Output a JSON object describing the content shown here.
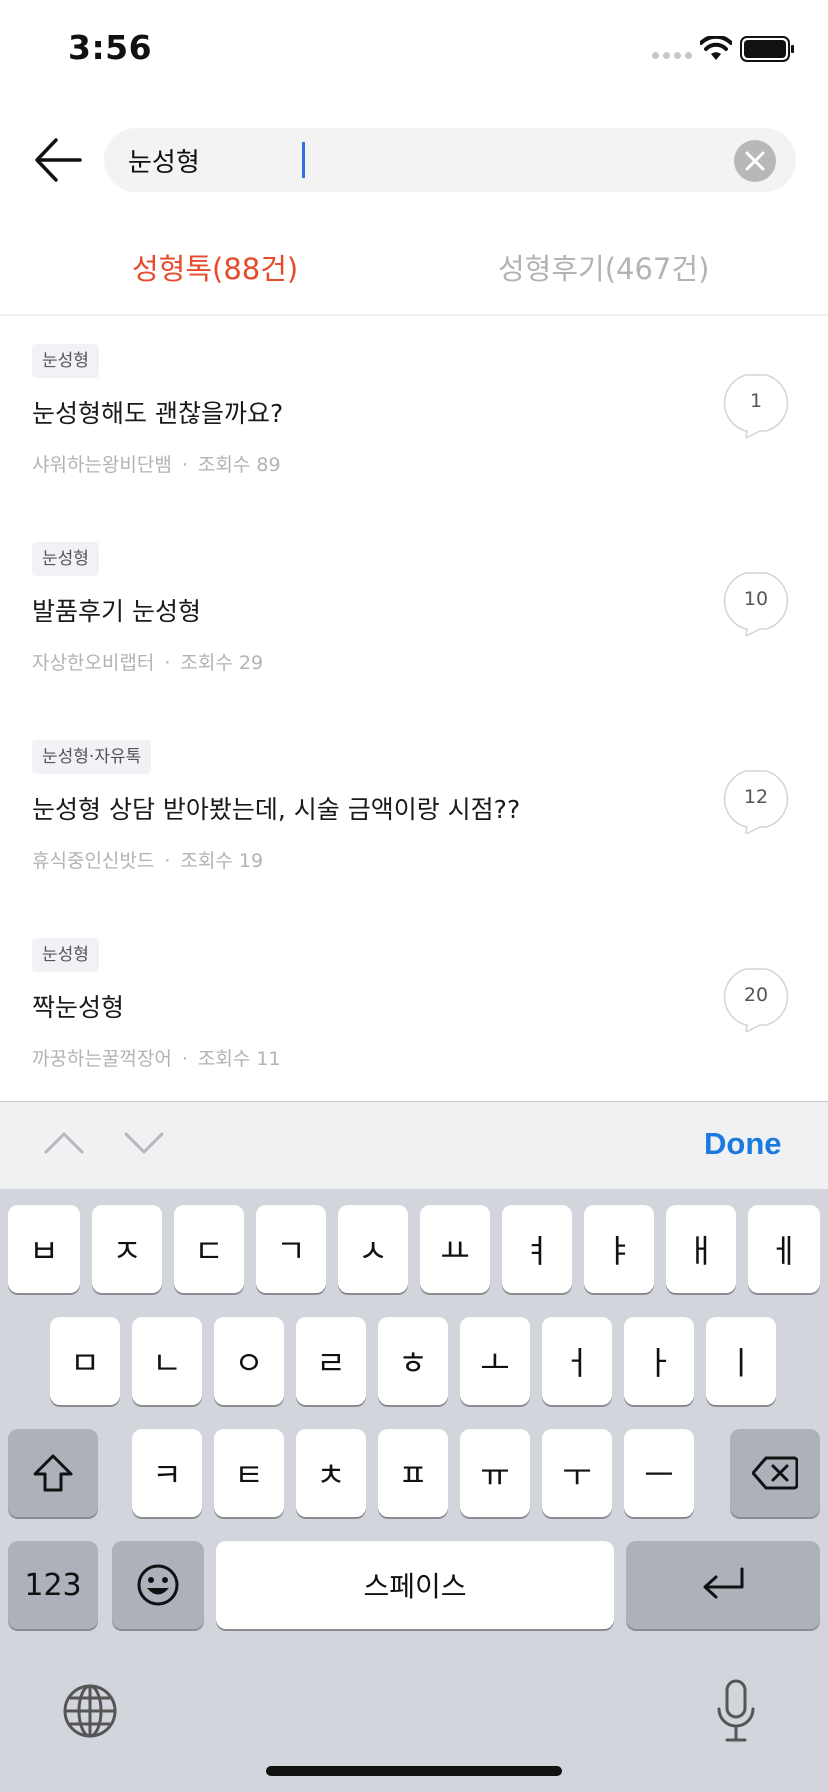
{
  "status_bar": {
    "time": "3:56"
  },
  "search": {
    "query": "눈성형"
  },
  "tabs": [
    {
      "label": "성형톡(88건)",
      "active": true
    },
    {
      "label": "성형후기(467건)",
      "active": false
    }
  ],
  "posts": [
    {
      "tag": "눈성형",
      "title": "눈성형해도 괜찮을까요?",
      "author": "샤워하는왕비단뱀",
      "views": "조회수 89",
      "comments": "1"
    },
    {
      "tag": "눈성형",
      "title": "발품후기 눈성형",
      "author": "자상한오비랩터",
      "views": "조회수 29",
      "comments": "10"
    },
    {
      "tag": "눈성형·자유톡",
      "title": "눈성형 상담 받아봤는데, 시술 금액이랑 시점??",
      "author": "휴식중인신밧드",
      "views": "조회수 19",
      "comments": "12"
    },
    {
      "tag": "눈성형",
      "title": "짝눈성형",
      "author": "까꿍하는꿀꺽장어",
      "views": "조회수 11",
      "comments": "20"
    }
  ],
  "meta_separator": "·",
  "accessory": {
    "done_label": "Done"
  },
  "keyboard": {
    "row1": [
      "ㅂ",
      "ㅈ",
      "ㄷ",
      "ㄱ",
      "ㅅ",
      "ㅛ",
      "ㅕ",
      "ㅑ",
      "ㅐ",
      "ㅔ"
    ],
    "row2": [
      "ㅁ",
      "ㄴ",
      "ㅇ",
      "ㄹ",
      "ㅎ",
      "ㅗ",
      "ㅓ",
      "ㅏ",
      "ㅣ"
    ],
    "row3": [
      "ㅋ",
      "ㅌ",
      "ㅊ",
      "ㅍ",
      "ㅠ",
      "ㅜ",
      "ㅡ"
    ],
    "numbers_label": "123",
    "space_label": "스페이스"
  },
  "colors": {
    "accent": "#e84a2c",
    "done": "#1a7ae0"
  }
}
